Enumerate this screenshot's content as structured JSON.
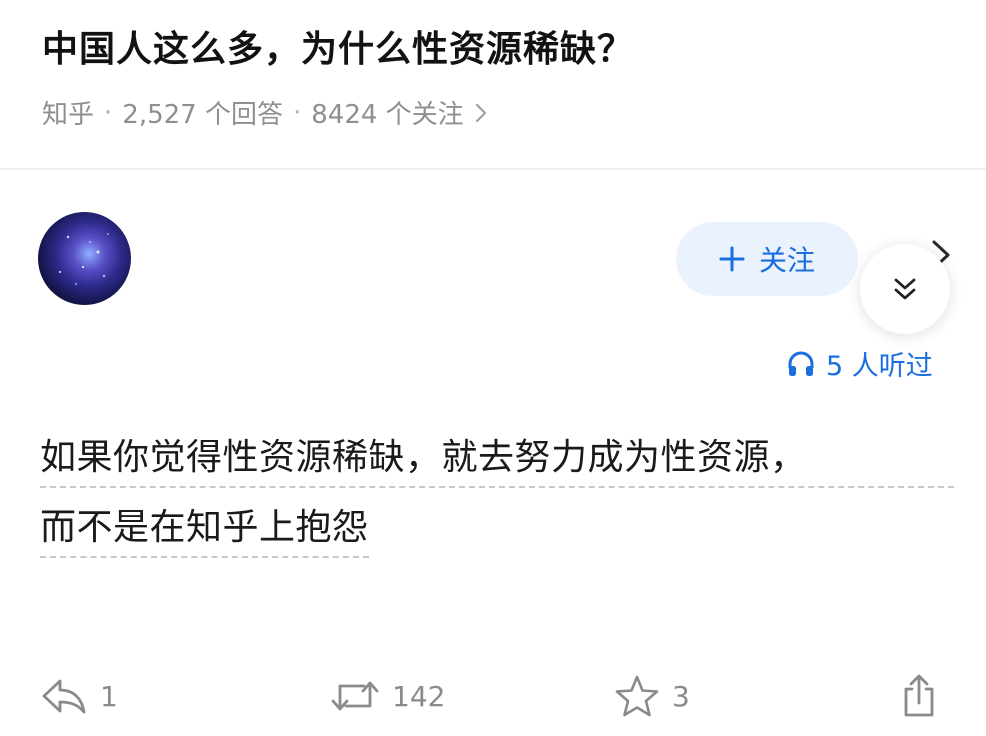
{
  "question": {
    "title": "中国人这么多，为什么性资源稀缺？",
    "source": "知乎",
    "separator": "·",
    "answers": "2,527 个回答",
    "followers": "8424 个关注"
  },
  "author": {
    "avatar_icon": "galaxy-avatar",
    "follow_label": "关注",
    "listen_count": "5 人听过"
  },
  "answer": {
    "line1": "如果你觉得性资源稀缺，就去努力成为性资源，",
    "line2": "而不是在知乎上抱怨"
  },
  "actions": {
    "reply_count": "1",
    "repost_count": "142",
    "star_count": "3"
  },
  "colors": {
    "accent": "#1a6fe0",
    "follow_bg": "#eaf2fd",
    "muted": "#8a8a8a"
  }
}
